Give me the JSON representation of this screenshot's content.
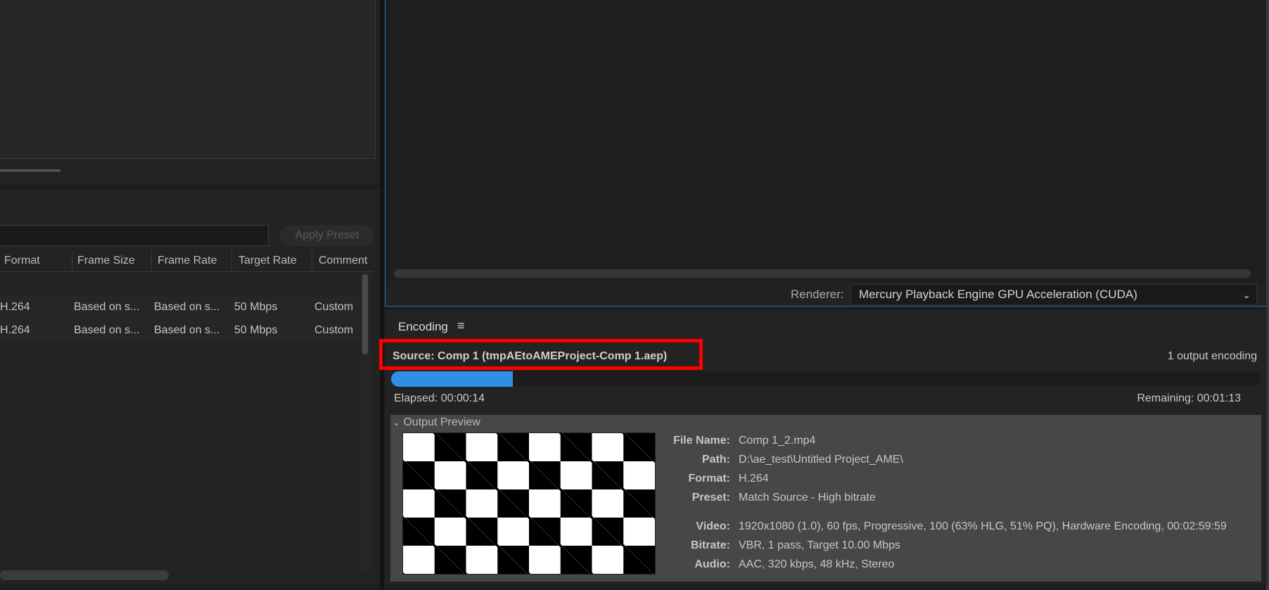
{
  "presets": {
    "apply_label": "Apply Preset",
    "columns": [
      "Format",
      "Frame Size",
      "Frame Rate",
      "Target Rate",
      "Comment"
    ],
    "rows": [
      {
        "format": "H.264",
        "frame_size": "Based on s...",
        "frame_rate": "Based on s...",
        "target_rate": "50 Mbps",
        "comment": "Custom"
      },
      {
        "format": "H.264",
        "frame_size": "Based on s...",
        "frame_rate": "Based on s...",
        "target_rate": "50 Mbps",
        "comment": "Custom"
      }
    ]
  },
  "preview": {
    "renderer_label": "Renderer:",
    "renderer_value": "Mercury Playback Engine GPU Acceleration (CUDA)"
  },
  "encoding": {
    "tab_label": "Encoding",
    "menu_icon": "hamburger-menu-icon",
    "source": "Source: Comp 1 (tmpAEtoAMEProject-Comp 1.aep)",
    "output_count": "1 output encoding",
    "progress_fraction": 0.14,
    "progress_color": "#2f8fe6",
    "elapsed": "Elapsed: 00:00:14",
    "remaining": "Remaining: 00:01:13",
    "output_preview": {
      "header": "Output Preview",
      "fields": [
        {
          "label": "File Name:",
          "value": "Comp 1_2.mp4"
        },
        {
          "label": "Path:",
          "value": "D:\\ae_test\\Untitled Project_AME\\"
        },
        {
          "label": "Format:",
          "value": "H.264"
        },
        {
          "label": "Preset:",
          "value": "Match Source - High bitrate"
        },
        {
          "label": "Video:",
          "value": "1920x1080 (1.0), 60 fps, Progressive, 100 (63% HLG, 51% PQ), Hardware Encoding, 00:02:59:59"
        },
        {
          "label": "Bitrate:",
          "value": "VBR, 1 pass, Target 10.00 Mbps"
        },
        {
          "label": "Audio:",
          "value": "AAC, 320 kbps, 48 kHz, Stereo"
        }
      ]
    }
  },
  "colors": {
    "highlight_box": "#ff0000",
    "panel_focus_border": "#2b6eb5"
  }
}
